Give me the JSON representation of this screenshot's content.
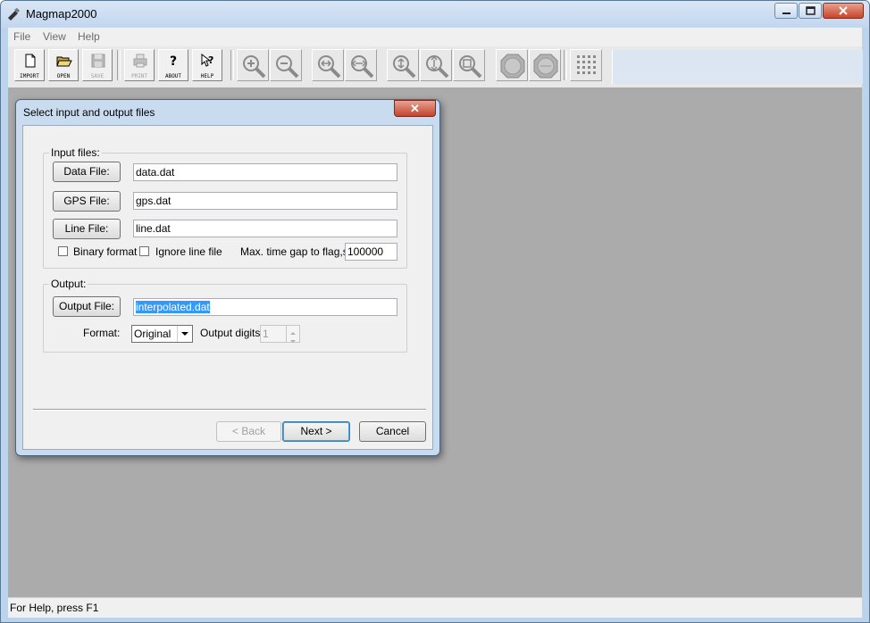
{
  "app": {
    "title": "Magmap2000",
    "status": "For Help, press F1"
  },
  "menu": [
    "File",
    "View",
    "Help"
  ],
  "toolbar": {
    "import": "IMPORT",
    "open": "OPEN",
    "save": "SAVE",
    "print": "PRINT",
    "about": "ABOUT",
    "help": "HELP"
  },
  "dialog": {
    "title": "Select input and output files",
    "input_group": "Input files:",
    "data_file_btn": "Data File:",
    "data_file": "data.dat",
    "gps_file_btn": "GPS File:",
    "gps_file": "gps.dat",
    "line_file_btn": "Line File:",
    "line_file": "line.dat",
    "binary_format": "Binary format",
    "ignore_line": "Ignore line file",
    "max_gap_label": "Max. time gap to flag,s:",
    "max_gap": "100000",
    "output_group": "Output:",
    "output_file_btn": "Output File:",
    "output_file": "interpolated.dat",
    "format_label": "Format:",
    "format_value": "Original",
    "digits_label": "Output digits:",
    "digits_value": "1",
    "back": "< Back",
    "next": "Next >",
    "cancel": "Cancel"
  }
}
